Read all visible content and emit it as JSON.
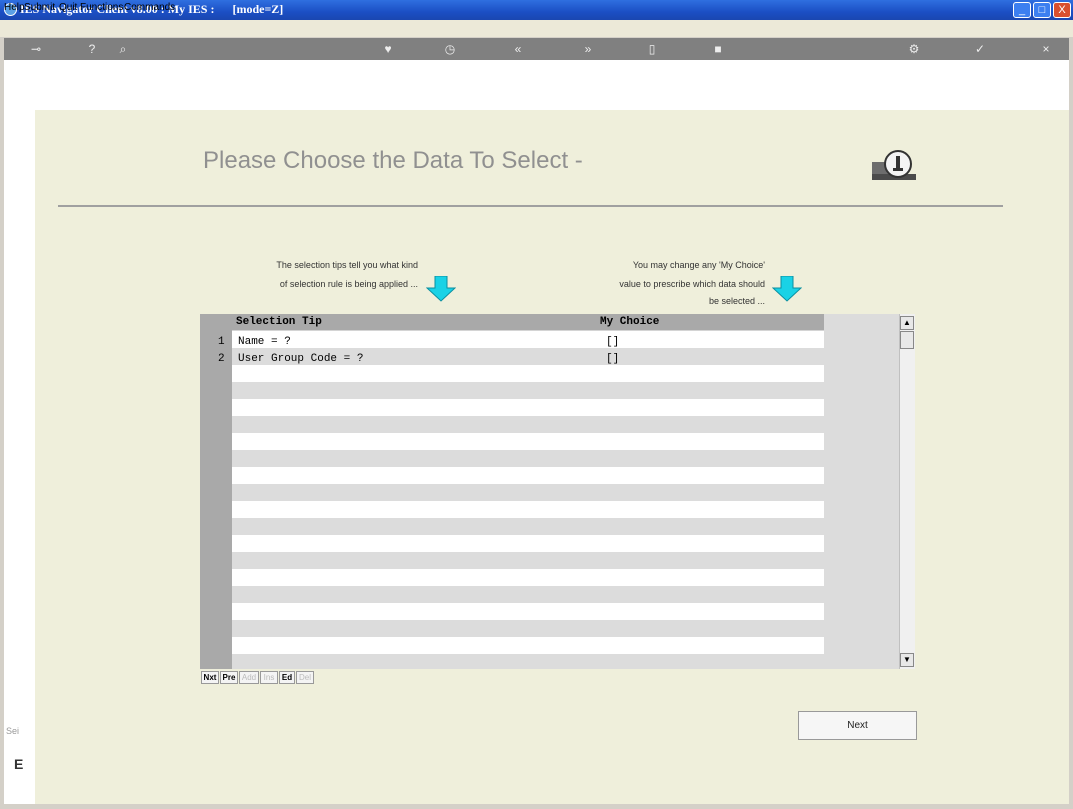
{
  "window": {
    "title": "IES Navigator Client v8.00 : My IES :      [mode=Z]",
    "controls": {
      "minimize": "_",
      "maximize": "□",
      "close": "X"
    }
  },
  "menu": [
    "Help",
    "Submit",
    "Quit",
    "Functions",
    "Commands"
  ],
  "toolbar": {
    "icons": [
      "key-icon",
      "help-icon",
      "search-icon",
      "heart-icon",
      "clock-icon",
      "rewind-icon",
      "fast-forward-icon",
      "page-icon",
      "stop-icon",
      "settings-icon",
      "ok-icon",
      "close-icon"
    ]
  },
  "page": {
    "heading": "Please Choose the Data To Select -",
    "tip_left": [
      "The selection tips tell you what kind",
      "of selection rule is being applied ..."
    ],
    "tip_right": [
      "You may change any 'My Choice'",
      "value to prescribe which data should",
      "be selected ..."
    ],
    "arrow_color": "#19d2e6"
  },
  "grid": {
    "columns": [
      "Selection Tip",
      "My Choice"
    ],
    "rows": [
      {
        "num": "1",
        "tip": "Name = ?",
        "choice": "[]"
      },
      {
        "num": "2",
        "tip": "User Group Code = ?",
        "choice": "[]"
      }
    ]
  },
  "nav_buttons": [
    "Nxt",
    "Pre",
    "Add",
    "Ins",
    "Ed",
    "Del"
  ],
  "next_button": "Next",
  "side_fragments": [
    "Sei",
    "E"
  ]
}
